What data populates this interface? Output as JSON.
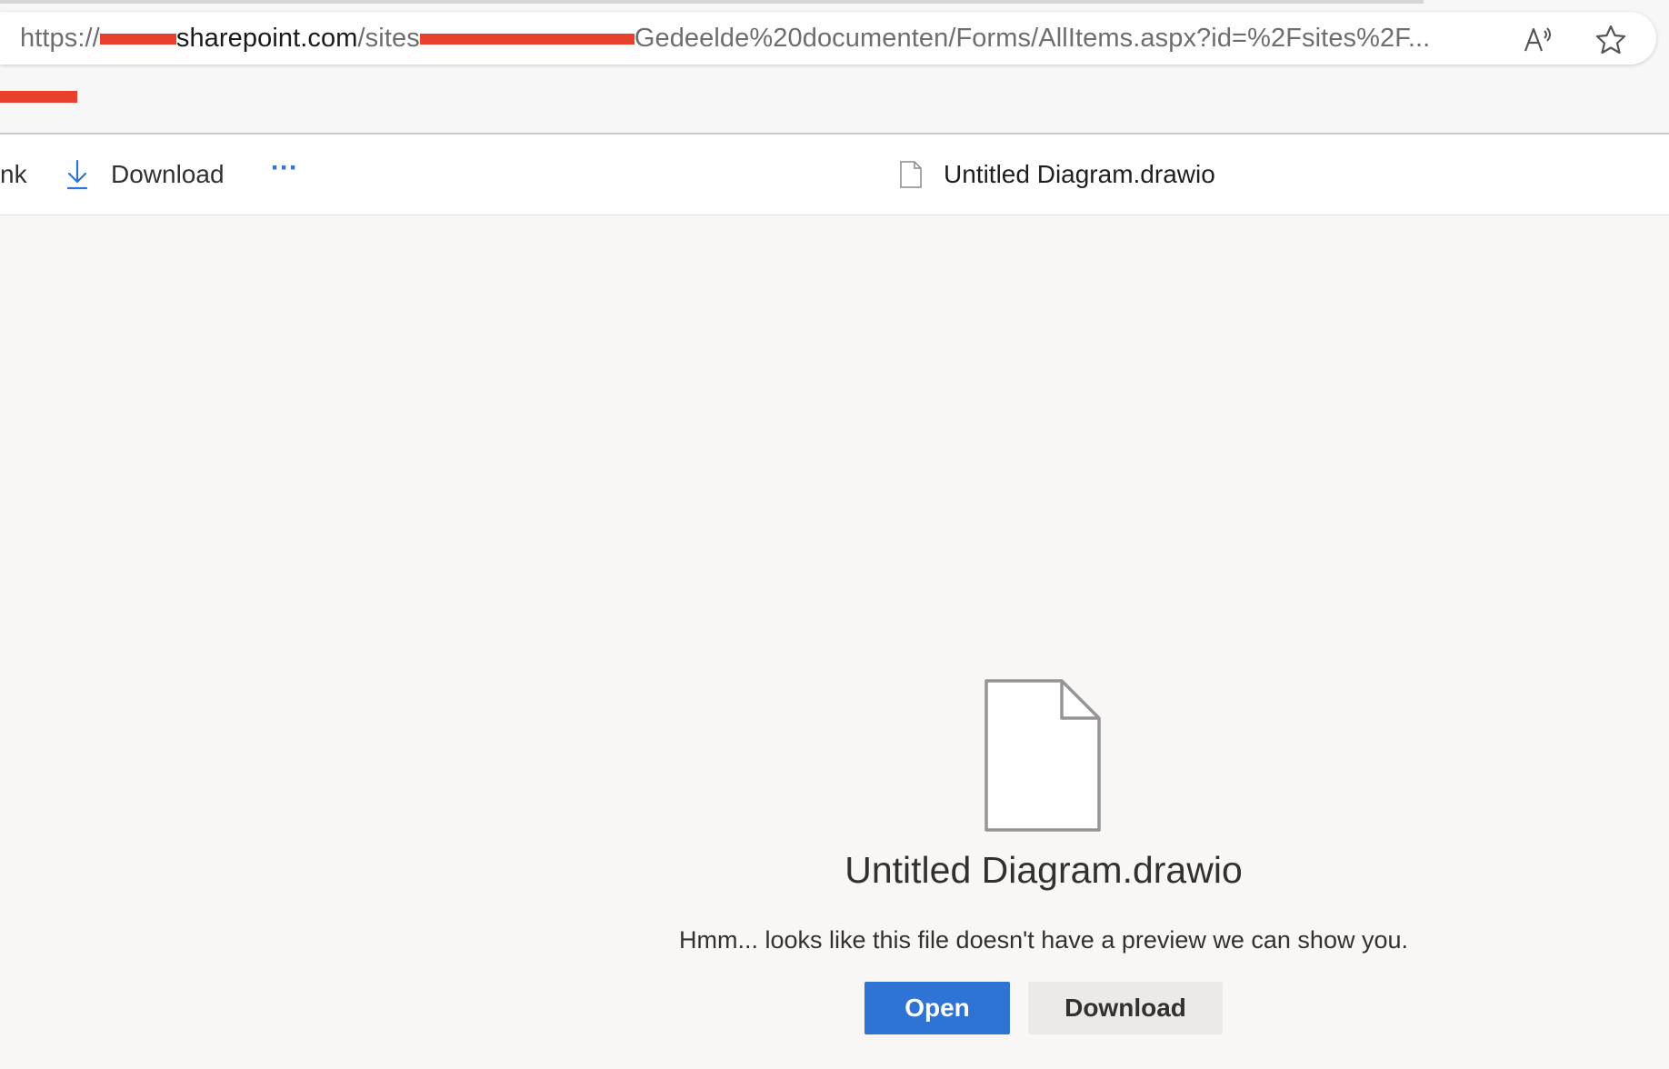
{
  "browser": {
    "url": {
      "scheme": "https://",
      "host": "sharepoint.com",
      "path_start": "/sites",
      "path_end": "Gedeelde%20documenten/Forms/AllItems.aspx?id=%2Fsites%2F..."
    },
    "read_aloud_icon": "read-aloud-icon",
    "favorite_icon": "star-icon"
  },
  "command_bar": {
    "truncated_item_label": "nk",
    "download_label": "Download",
    "more_label": "···",
    "file_name": "Untitled Diagram.drawio"
  },
  "preview": {
    "file_name": "Untitled Diagram.drawio",
    "message": "Hmm... looks like this file doesn't have a preview we can show you.",
    "open_label": "Open",
    "download_label": "Download"
  },
  "colors": {
    "accent": "#2f73d4",
    "redaction": "#e8402d"
  }
}
